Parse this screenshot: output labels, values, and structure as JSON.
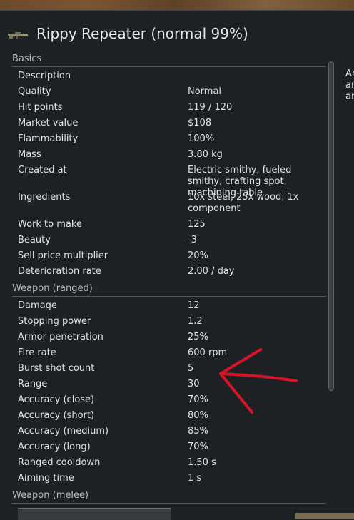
{
  "window": {
    "title": "Rippy Repeater (normal 99%)",
    "weapon_icon": "rifle-icon"
  },
  "sections": {
    "basics": {
      "header": "Basics",
      "rows": [
        {
          "label": "Description",
          "value": ""
        },
        {
          "label": "Quality",
          "value": "Normal"
        },
        {
          "label": "Hit points",
          "value": "119 / 120"
        },
        {
          "label": "Market value",
          "value": "$108"
        },
        {
          "label": "Flammability",
          "value": "100%"
        },
        {
          "label": "Mass",
          "value": "3.80 kg"
        },
        {
          "label": "Created at",
          "value": "Electric smithy, fueled smithy, crafting spot, machining table"
        },
        {
          "label": "Ingredients",
          "value": "10x steel, 25x wood, 1x component"
        },
        {
          "label": "Work to make",
          "value": "125"
        },
        {
          "label": "Beauty",
          "value": "-3"
        },
        {
          "label": "Sell price multiplier",
          "value": "20%"
        },
        {
          "label": "Deterioration rate",
          "value": "2.00 / day"
        }
      ]
    },
    "ranged": {
      "header": "Weapon (ranged)",
      "rows": [
        {
          "label": "Damage",
          "value": "12"
        },
        {
          "label": "Stopping power",
          "value": "1.2"
        },
        {
          "label": "Armor penetration",
          "value": "25%"
        },
        {
          "label": "Fire rate",
          "value": "600 rpm"
        },
        {
          "label": "Burst shot count",
          "value": "5"
        },
        {
          "label": "Range",
          "value": "30"
        },
        {
          "label": "Accuracy (close)",
          "value": "70%"
        },
        {
          "label": "Accuracy (short)",
          "value": "80%"
        },
        {
          "label": "Accuracy (medium)",
          "value": "85%"
        },
        {
          "label": "Accuracy (long)",
          "value": "70%"
        },
        {
          "label": "Ranged cooldown",
          "value": "1.50 s"
        },
        {
          "label": "Aiming time",
          "value": "1 s"
        }
      ]
    },
    "melee": {
      "header": "Weapon (melee)"
    }
  },
  "side_panel": {
    "text_lines": [
      "An",
      "an",
      "an"
    ]
  },
  "annotation": {
    "arrow_color": "#d8142a",
    "arrow_icon": "red-arrow-annotation"
  },
  "colors": {
    "background": "#1e2124",
    "text": "#e2e2e2",
    "header_text": "#b9babb",
    "divider": "#55595d"
  }
}
